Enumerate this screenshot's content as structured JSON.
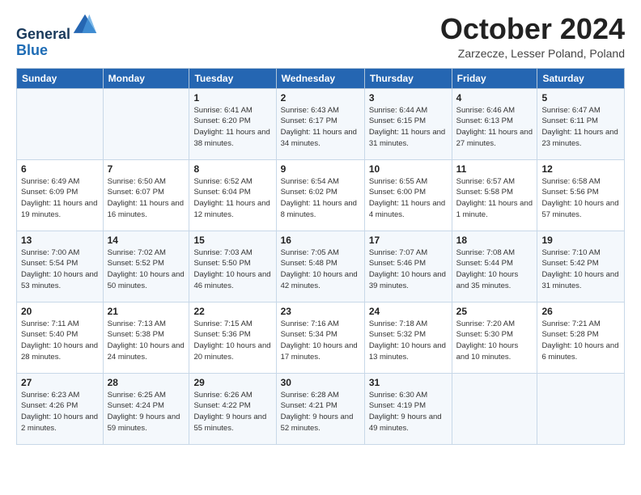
{
  "logo": {
    "line1": "General",
    "line2": "Blue"
  },
  "header": {
    "title": "October 2024",
    "subtitle": "Zarzecze, Lesser Poland, Poland"
  },
  "weekdays": [
    "Sunday",
    "Monday",
    "Tuesday",
    "Wednesday",
    "Thursday",
    "Friday",
    "Saturday"
  ],
  "weeks": [
    [
      {
        "day": "",
        "info": ""
      },
      {
        "day": "",
        "info": ""
      },
      {
        "day": "1",
        "info": "Sunrise: 6:41 AM\nSunset: 6:20 PM\nDaylight: 11 hours and 38 minutes."
      },
      {
        "day": "2",
        "info": "Sunrise: 6:43 AM\nSunset: 6:17 PM\nDaylight: 11 hours and 34 minutes."
      },
      {
        "day": "3",
        "info": "Sunrise: 6:44 AM\nSunset: 6:15 PM\nDaylight: 11 hours and 31 minutes."
      },
      {
        "day": "4",
        "info": "Sunrise: 6:46 AM\nSunset: 6:13 PM\nDaylight: 11 hours and 27 minutes."
      },
      {
        "day": "5",
        "info": "Sunrise: 6:47 AM\nSunset: 6:11 PM\nDaylight: 11 hours and 23 minutes."
      }
    ],
    [
      {
        "day": "6",
        "info": "Sunrise: 6:49 AM\nSunset: 6:09 PM\nDaylight: 11 hours and 19 minutes."
      },
      {
        "day": "7",
        "info": "Sunrise: 6:50 AM\nSunset: 6:07 PM\nDaylight: 11 hours and 16 minutes."
      },
      {
        "day": "8",
        "info": "Sunrise: 6:52 AM\nSunset: 6:04 PM\nDaylight: 11 hours and 12 minutes."
      },
      {
        "day": "9",
        "info": "Sunrise: 6:54 AM\nSunset: 6:02 PM\nDaylight: 11 hours and 8 minutes."
      },
      {
        "day": "10",
        "info": "Sunrise: 6:55 AM\nSunset: 6:00 PM\nDaylight: 11 hours and 4 minutes."
      },
      {
        "day": "11",
        "info": "Sunrise: 6:57 AM\nSunset: 5:58 PM\nDaylight: 11 hours and 1 minute."
      },
      {
        "day": "12",
        "info": "Sunrise: 6:58 AM\nSunset: 5:56 PM\nDaylight: 10 hours and 57 minutes."
      }
    ],
    [
      {
        "day": "13",
        "info": "Sunrise: 7:00 AM\nSunset: 5:54 PM\nDaylight: 10 hours and 53 minutes."
      },
      {
        "day": "14",
        "info": "Sunrise: 7:02 AM\nSunset: 5:52 PM\nDaylight: 10 hours and 50 minutes."
      },
      {
        "day": "15",
        "info": "Sunrise: 7:03 AM\nSunset: 5:50 PM\nDaylight: 10 hours and 46 minutes."
      },
      {
        "day": "16",
        "info": "Sunrise: 7:05 AM\nSunset: 5:48 PM\nDaylight: 10 hours and 42 minutes."
      },
      {
        "day": "17",
        "info": "Sunrise: 7:07 AM\nSunset: 5:46 PM\nDaylight: 10 hours and 39 minutes."
      },
      {
        "day": "18",
        "info": "Sunrise: 7:08 AM\nSunset: 5:44 PM\nDaylight: 10 hours and 35 minutes."
      },
      {
        "day": "19",
        "info": "Sunrise: 7:10 AM\nSunset: 5:42 PM\nDaylight: 10 hours and 31 minutes."
      }
    ],
    [
      {
        "day": "20",
        "info": "Sunrise: 7:11 AM\nSunset: 5:40 PM\nDaylight: 10 hours and 28 minutes."
      },
      {
        "day": "21",
        "info": "Sunrise: 7:13 AM\nSunset: 5:38 PM\nDaylight: 10 hours and 24 minutes."
      },
      {
        "day": "22",
        "info": "Sunrise: 7:15 AM\nSunset: 5:36 PM\nDaylight: 10 hours and 20 minutes."
      },
      {
        "day": "23",
        "info": "Sunrise: 7:16 AM\nSunset: 5:34 PM\nDaylight: 10 hours and 17 minutes."
      },
      {
        "day": "24",
        "info": "Sunrise: 7:18 AM\nSunset: 5:32 PM\nDaylight: 10 hours and 13 minutes."
      },
      {
        "day": "25",
        "info": "Sunrise: 7:20 AM\nSunset: 5:30 PM\nDaylight: 10 hours and 10 minutes."
      },
      {
        "day": "26",
        "info": "Sunrise: 7:21 AM\nSunset: 5:28 PM\nDaylight: 10 hours and 6 minutes."
      }
    ],
    [
      {
        "day": "27",
        "info": "Sunrise: 6:23 AM\nSunset: 4:26 PM\nDaylight: 10 hours and 2 minutes."
      },
      {
        "day": "28",
        "info": "Sunrise: 6:25 AM\nSunset: 4:24 PM\nDaylight: 9 hours and 59 minutes."
      },
      {
        "day": "29",
        "info": "Sunrise: 6:26 AM\nSunset: 4:22 PM\nDaylight: 9 hours and 55 minutes."
      },
      {
        "day": "30",
        "info": "Sunrise: 6:28 AM\nSunset: 4:21 PM\nDaylight: 9 hours and 52 minutes."
      },
      {
        "day": "31",
        "info": "Sunrise: 6:30 AM\nSunset: 4:19 PM\nDaylight: 9 hours and 49 minutes."
      },
      {
        "day": "",
        "info": ""
      },
      {
        "day": "",
        "info": ""
      }
    ]
  ]
}
